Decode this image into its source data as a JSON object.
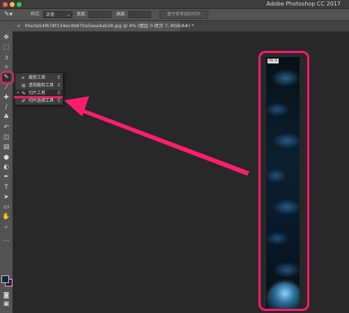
{
  "app": {
    "title": "Adobe Photoshop CC 2017"
  },
  "options_bar": {
    "tool_icon": "slice-tool-icon",
    "style_label": "样式:",
    "style_value": "正常",
    "width_label": "宽度:",
    "height_label": "高度:",
    "guides_button": "基于参考线的切片"
  },
  "document_tab": {
    "close_glyph": "×",
    "title": "05e3a54f678f134ec4b870a5eea4ab28.jpg @ 4% (图层 0 拷贝 7, RGB/8#) *"
  },
  "toolbox": {
    "tools": [
      {
        "name": "move-tool",
        "glyph": "✥"
      },
      {
        "name": "marquee-tool",
        "glyph": "⬚"
      },
      {
        "name": "lasso-tool",
        "glyph": "ↄ"
      },
      {
        "name": "quick-selection-tool",
        "glyph": "✧"
      },
      {
        "name": "slice-tool",
        "glyph": "✎",
        "active": true
      },
      {
        "name": "eyedropper-tool",
        "glyph": "⁄"
      },
      {
        "name": "healing-brush-tool",
        "glyph": "✚"
      },
      {
        "name": "brush-tool",
        "glyph": "∕"
      },
      {
        "name": "clone-stamp-tool",
        "glyph": "♣"
      },
      {
        "name": "history-brush-tool",
        "glyph": "↶"
      },
      {
        "name": "eraser-tool",
        "glyph": "◫"
      },
      {
        "name": "gradient-tool",
        "glyph": "▤"
      },
      {
        "name": "blur-tool",
        "glyph": "●"
      },
      {
        "name": "dodge-tool",
        "glyph": "◐"
      },
      {
        "name": "pen-tool",
        "glyph": "✒"
      },
      {
        "name": "type-tool",
        "glyph": "T"
      },
      {
        "name": "path-selection-tool",
        "glyph": "➤"
      },
      {
        "name": "rectangle-tool",
        "glyph": "▭"
      },
      {
        "name": "hand-tool",
        "glyph": "✋"
      },
      {
        "name": "zoom-tool",
        "glyph": "⌕"
      },
      {
        "name": "more-tools",
        "glyph": "⋯"
      },
      {
        "name": "quick-mask-tool",
        "glyph": "◙"
      },
      {
        "name": "screen-mode-tool",
        "glyph": "▣"
      }
    ],
    "colors": {
      "foreground": "#0d2b3a",
      "background": "#4a0f33"
    }
  },
  "flyout": {
    "items": [
      {
        "label": "裁剪工具",
        "key": "C",
        "icon": "crop-icon",
        "glyph": "⌗",
        "bullet": ""
      },
      {
        "label": "透视裁剪工具",
        "key": "C",
        "icon": "perspective-crop-icon",
        "glyph": "⊞",
        "bullet": ""
      },
      {
        "label": "切片工具",
        "key": "C",
        "icon": "slice-icon",
        "glyph": "✎",
        "bullet": "•"
      },
      {
        "label": "切片选择工具",
        "key": "C",
        "icon": "slice-select-icon",
        "glyph": "✐",
        "bullet": ""
      }
    ]
  },
  "canvas": {
    "slice_badge": "01 ⊡"
  },
  "annotation": {
    "color": "#ff1d6c"
  }
}
